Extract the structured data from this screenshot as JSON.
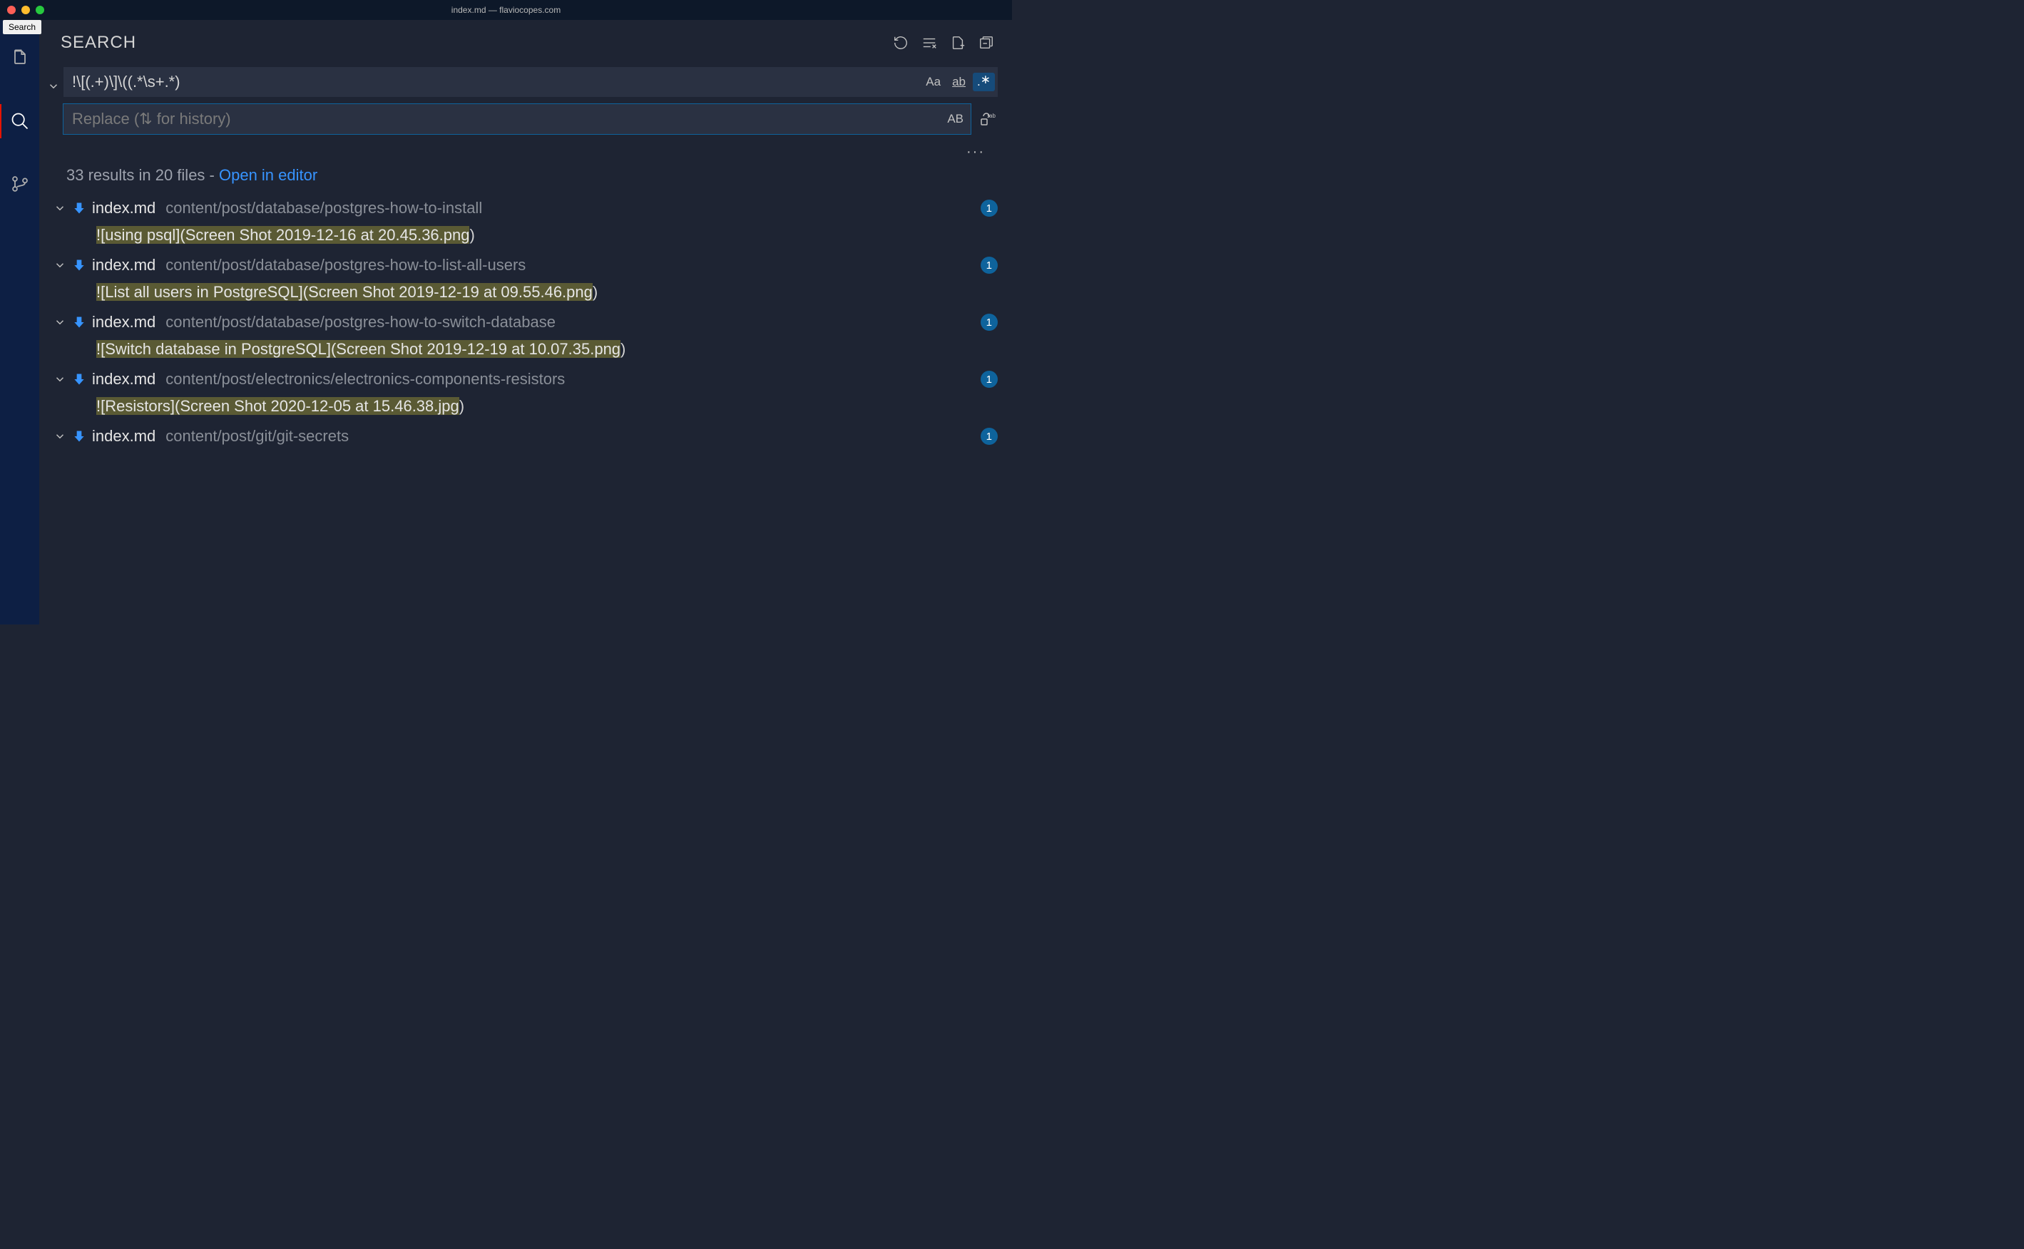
{
  "window": {
    "title": "index.md — flaviocopes.com",
    "tooltip": "Search"
  },
  "sidebar": {
    "title": "SEARCH"
  },
  "search": {
    "query": "!\\[(.+)\\]\\((.*\\s+.*)",
    "replace_placeholder": "Replace (⇅ for history)",
    "opt_case": "Aa",
    "opt_word": "ab",
    "opt_regex": "∗",
    "opt_preserve": "AB"
  },
  "summary": {
    "text": "33 results in 20 files - ",
    "link": "Open in editor"
  },
  "results": [
    {
      "filename": "index.md",
      "path": "content/post/database/postgres-how-to-install",
      "count": "1",
      "match": "![using psql](Screen Shot 2019-12-16 at 20.45.36.png)",
      "highlight_start": 0,
      "highlight_end": 52
    },
    {
      "filename": "index.md",
      "path": "content/post/database/postgres-how-to-list-all-users",
      "count": "1",
      "match": "![List all users in PostgreSQL](Screen Shot 2019-12-19 at 09.55.46.png)",
      "highlight_start": 0,
      "highlight_end": 70
    },
    {
      "filename": "index.md",
      "path": "content/post/database/postgres-how-to-switch-database",
      "count": "1",
      "match": "![Switch database in PostgreSQL](Screen Shot 2019-12-19 at 10.07.35.png)",
      "highlight_start": 0,
      "highlight_end": 71
    },
    {
      "filename": "index.md",
      "path": "content/post/electronics/electronics-components-resistors",
      "count": "1",
      "match": "![Resistors](Screen Shot 2020-12-05 at 15.46.38.jpg)",
      "highlight_start": 0,
      "highlight_end": 51
    },
    {
      "filename": "index.md",
      "path": "content/post/git/git-secrets",
      "count": "1",
      "match": "",
      "highlight_start": 0,
      "highlight_end": 0
    }
  ]
}
